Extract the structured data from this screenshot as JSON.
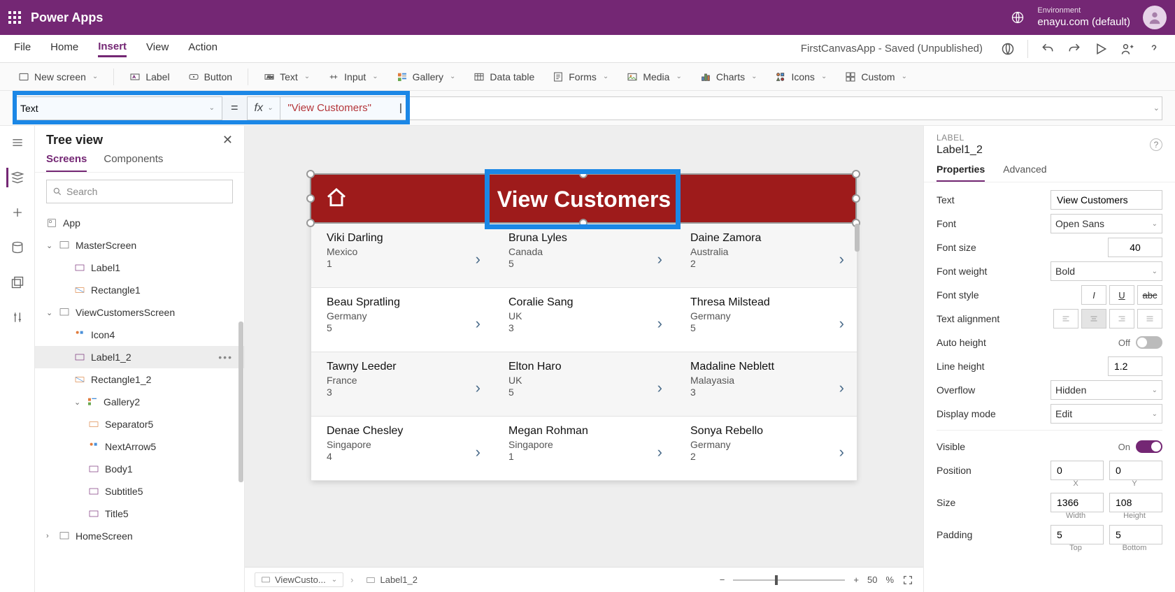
{
  "suite": {
    "app_name": "Power Apps",
    "env_label": "Environment",
    "env_value": "enayu.com (default)"
  },
  "menu": {
    "items": [
      "File",
      "Home",
      "Insert",
      "View",
      "Action"
    ],
    "active": "Insert",
    "doc_title": "FirstCanvasApp - Saved (Unpublished)"
  },
  "ribbon": {
    "new_screen": "New screen",
    "label": "Label",
    "button": "Button",
    "text": "Text",
    "input": "Input",
    "gallery": "Gallery",
    "data_table": "Data table",
    "forms": "Forms",
    "media": "Media",
    "charts": "Charts",
    "icons": "Icons",
    "custom": "Custom"
  },
  "formula": {
    "property": "Text",
    "fx": "fx",
    "expression": "\"View Customers\""
  },
  "tree": {
    "title": "Tree view",
    "tabs": {
      "screens": "Screens",
      "components": "Components"
    },
    "search_placeholder": "Search",
    "nodes": {
      "app": "App",
      "master": "MasterScreen",
      "label1": "Label1",
      "rect1": "Rectangle1",
      "viewcust": "ViewCustomersScreen",
      "icon4": "Icon4",
      "label12": "Label1_2",
      "rect12": "Rectangle1_2",
      "gallery2": "Gallery2",
      "sep5": "Separator5",
      "next5": "NextArrow5",
      "body1": "Body1",
      "subtitle5": "Subtitle5",
      "title5": "Title5",
      "home": "HomeScreen"
    }
  },
  "canvas": {
    "header_title": "View Customers",
    "rows": [
      [
        {
          "name": "Viki  Darling",
          "country": "Mexico",
          "num": "1"
        },
        {
          "name": "Bruna  Lyles",
          "country": "Canada",
          "num": "5"
        },
        {
          "name": "Daine  Zamora",
          "country": "Australia",
          "num": "2"
        }
      ],
      [
        {
          "name": "Beau  Spratling",
          "country": "Germany",
          "num": "5"
        },
        {
          "name": "Coralie  Sang",
          "country": "UK",
          "num": "3"
        },
        {
          "name": "Thresa  Milstead",
          "country": "Germany",
          "num": "5"
        }
      ],
      [
        {
          "name": "Tawny  Leeder",
          "country": "France",
          "num": "3"
        },
        {
          "name": "Elton  Haro",
          "country": "UK",
          "num": "5"
        },
        {
          "name": "Madaline  Neblett",
          "country": "Malayasia",
          "num": "3"
        }
      ],
      [
        {
          "name": "Denae  Chesley",
          "country": "Singapore",
          "num": "4"
        },
        {
          "name": "Megan  Rohman",
          "country": "Singapore",
          "num": "1"
        },
        {
          "name": "Sonya  Rebello",
          "country": "Germany",
          "num": "2"
        }
      ]
    ]
  },
  "breadcrumb": {
    "screen": "ViewCusto...",
    "element": "Label1_2"
  },
  "zoom": {
    "dec": "−",
    "inc": "+",
    "value": "50",
    "pct": "%"
  },
  "props": {
    "kind": "LABEL",
    "name": "Label1_2",
    "tabs": {
      "properties": "Properties",
      "advanced": "Advanced"
    },
    "rows": {
      "text_lbl": "Text",
      "text_val": "View Customers",
      "font_lbl": "Font",
      "font_val": "Open Sans",
      "fontsize_lbl": "Font size",
      "fontsize_val": "40",
      "fontweight_lbl": "Font weight",
      "fontweight_val": "Bold",
      "fontstyle_lbl": "Font style",
      "align_lbl": "Text alignment",
      "autoheight_lbl": "Auto height",
      "autoheight_state": "Off",
      "lineheight_lbl": "Line height",
      "lineheight_val": "1.2",
      "overflow_lbl": "Overflow",
      "overflow_val": "Hidden",
      "display_lbl": "Display mode",
      "display_val": "Edit",
      "visible_lbl": "Visible",
      "visible_state": "On",
      "position_lbl": "Position",
      "pos_x": "0",
      "pos_y": "0",
      "x_lbl": "X",
      "y_lbl": "Y",
      "size_lbl": "Size",
      "size_w": "1366",
      "size_h": "108",
      "w_lbl": "Width",
      "h_lbl": "Height",
      "padding_lbl": "Padding",
      "pad_t": "5",
      "pad_b": "5",
      "t_lbl": "Top",
      "b_lbl": "Bottom"
    }
  }
}
